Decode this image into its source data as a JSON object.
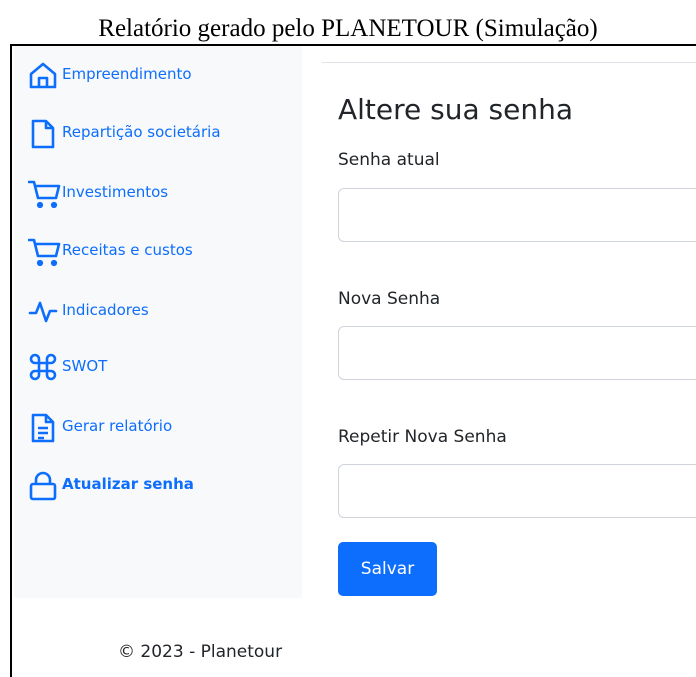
{
  "caption": "Relatório gerado pelo PLANETOUR (Simulação)",
  "sidebar": {
    "items": [
      {
        "label": "Empreendimento",
        "icon": "house-icon"
      },
      {
        "label": "Repartição societária",
        "icon": "file-icon"
      },
      {
        "label": "Investimentos",
        "icon": "cart-icon"
      },
      {
        "label": "Receitas e custos",
        "icon": "cart-icon"
      },
      {
        "label": "Indicadores",
        "icon": "activity-icon"
      },
      {
        "label": "SWOT",
        "icon": "command-icon"
      },
      {
        "label": "Gerar relatório",
        "icon": "file-text-icon"
      },
      {
        "label": "Atualizar senha",
        "icon": "lock-icon",
        "active": true
      }
    ]
  },
  "form": {
    "title": "Altere sua senha",
    "current_password_label": "Senha atual",
    "current_password_value": "",
    "new_password_label": "Nova Senha",
    "new_password_value": "",
    "repeat_password_label": "Repetir Nova Senha",
    "repeat_password_value": "",
    "save_label": "Salvar"
  },
  "footer": {
    "text": "© 2023 - Planetour"
  },
  "colors": {
    "primary": "#0d6efd",
    "sidebar_bg": "#f8f9fa",
    "text": "#212529"
  }
}
